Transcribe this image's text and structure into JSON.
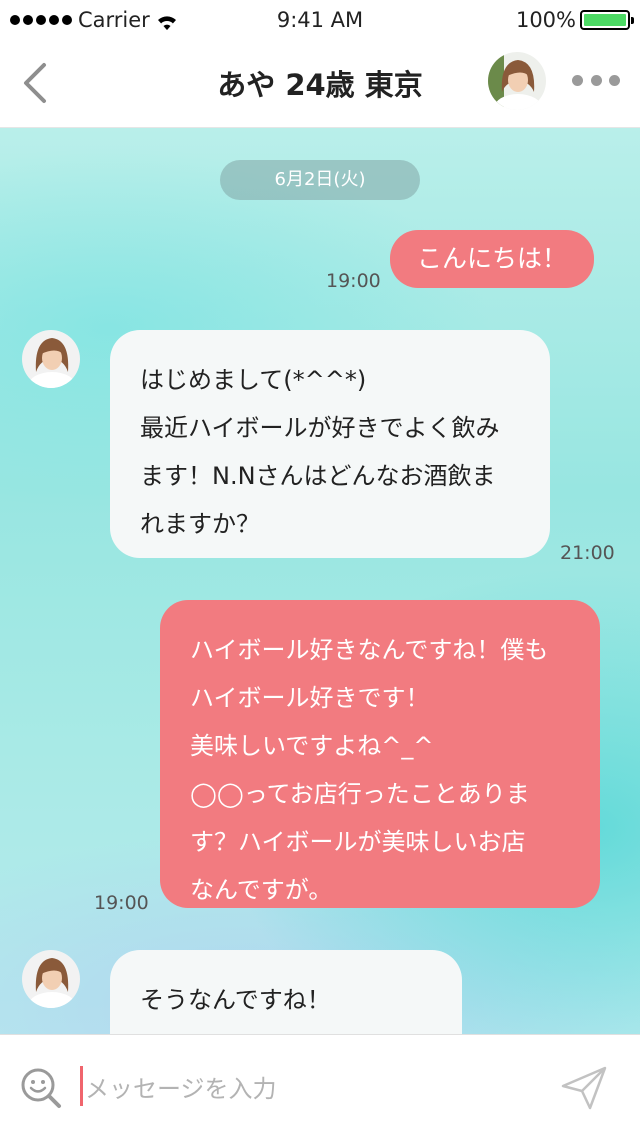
{
  "status_bar": {
    "carrier": "Carrier",
    "time": "9:41 AM",
    "battery": "100%"
  },
  "header": {
    "title": "あや 24歳 東京"
  },
  "chat": {
    "date": "6月2日(火)",
    "messages": [
      {
        "direction": "sent",
        "text": "こんにちは！",
        "time": "19:00"
      },
      {
        "direction": "received",
        "text": "はじめまして(*^^*)\n最近ハイボールが好きでよく飲み\nます！N.Nさんはどんなお酒飲ま\nれますか？",
        "time": "21:00"
      },
      {
        "direction": "sent",
        "text": "ハイボール好きなんですね！僕も\nハイボール好きです！\n美味しいですよね^_^\n◯◯ってお店行ったことありま\nす？ハイボールが美味しいお店\nなんですが。",
        "time": "19:00"
      },
      {
        "direction": "received",
        "text": "そうなんですね！\n行ったことないです"
      }
    ]
  },
  "input": {
    "placeholder": "メッセージを入力"
  },
  "colors": {
    "sent_bubble": "#f27b80",
    "received_bubble": "#f5f8f8",
    "battery": "#4cd964",
    "cursor": "#f0656d"
  }
}
